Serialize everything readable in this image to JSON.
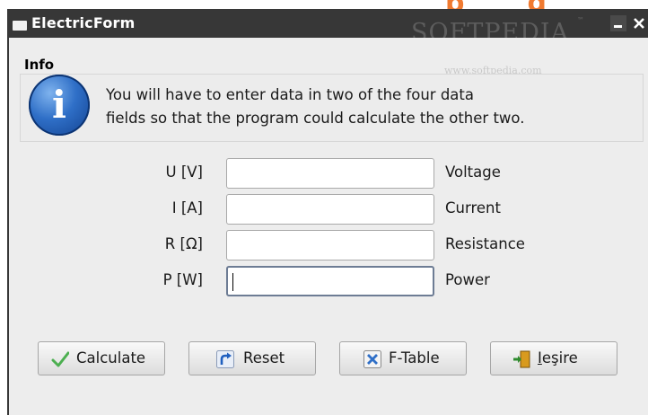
{
  "window": {
    "title": "ElectricForm",
    "overlay_fragment": "p",
    "overlay_fragment2": "g",
    "watermark_logo": "SOFTPEDIA",
    "watermark_tm": "™",
    "watermark_url": "www.softpedia.com"
  },
  "info": {
    "label": "Info",
    "line1": "You will have to enter data in two of the four data",
    "line2": "fields so that the program could calculate the other two."
  },
  "fields": [
    {
      "label": "U [V]",
      "value": "",
      "description": "Voltage"
    },
    {
      "label": "I [A]",
      "value": "",
      "description": "Current"
    },
    {
      "label": "R [Ω]",
      "value": "",
      "description": "Resistance"
    },
    {
      "label": "P [W]",
      "value": "",
      "description": "Power"
    }
  ],
  "buttons": {
    "calculate": "Calculate",
    "reset": "Reset",
    "ftable": "F-Table",
    "exit": "Ieşire",
    "exit_mnemonic": "I",
    "exit_rest": "eşire"
  },
  "colors": {
    "titlebar": "#373737",
    "background": "#ededed",
    "check_green": "#4caf50",
    "accent_blue": "#2f6fc7",
    "orange": "#f07a30"
  }
}
